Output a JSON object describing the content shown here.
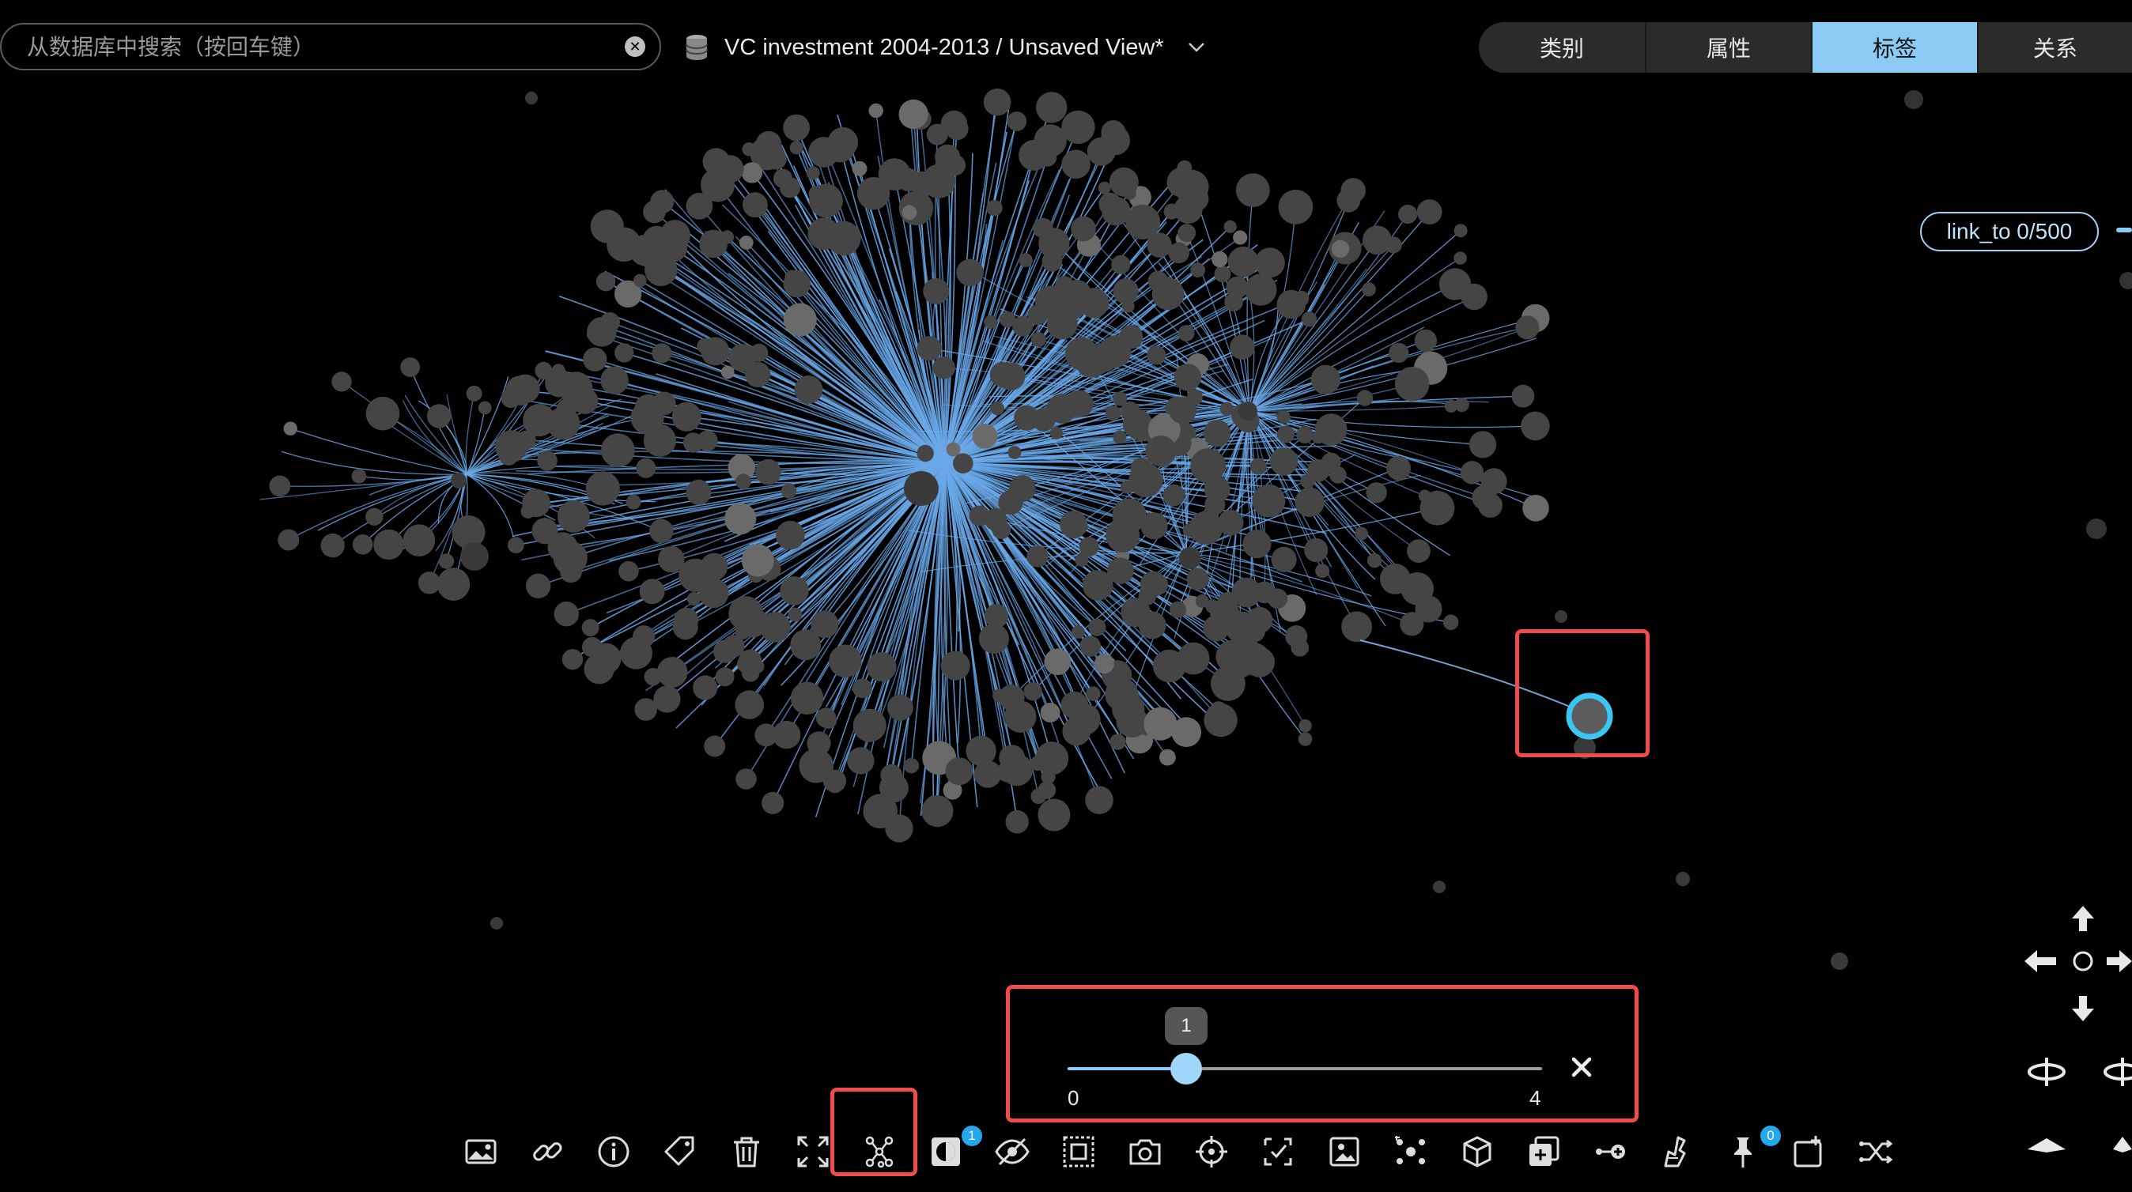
{
  "search": {
    "placeholder": "从数据库中搜索（按回车键）",
    "value": ""
  },
  "header": {
    "view_title": "VC investment 2004-2013 / Unsaved View*"
  },
  "tabs": [
    {
      "label": "类别",
      "active": false
    },
    {
      "label": "属性",
      "active": false
    },
    {
      "label": "标签",
      "active": true
    },
    {
      "label": "关系",
      "active": false
    }
  ],
  "link_badge": {
    "label": "link_to 0/500"
  },
  "slider": {
    "min": "0",
    "max": "4",
    "value": "1"
  },
  "toolbar": {
    "icons": [
      "image-icon",
      "link-icon",
      "info-icon",
      "tag-icon",
      "trash-icon",
      "expand-icon",
      "network-layout-icon",
      "contrast-icon",
      "hide-icon",
      "select-box-icon",
      "camera-icon",
      "crosshair-icon",
      "checkbox-select-icon",
      "image-select-icon",
      "cluster-icon",
      "cube-icon",
      "add-layer-icon",
      "add-node-icon",
      "brush-icon",
      "pin-icon",
      "window-add-icon",
      "shuffle-icon"
    ],
    "contrast_badge": "1",
    "pin_badge": "0"
  },
  "colors": {
    "edge": "#6aa8e8",
    "node": "#454545",
    "accent": "#8ccbf4",
    "highlight": "#ef4b4b",
    "selected_ring": "#39c6f4"
  }
}
